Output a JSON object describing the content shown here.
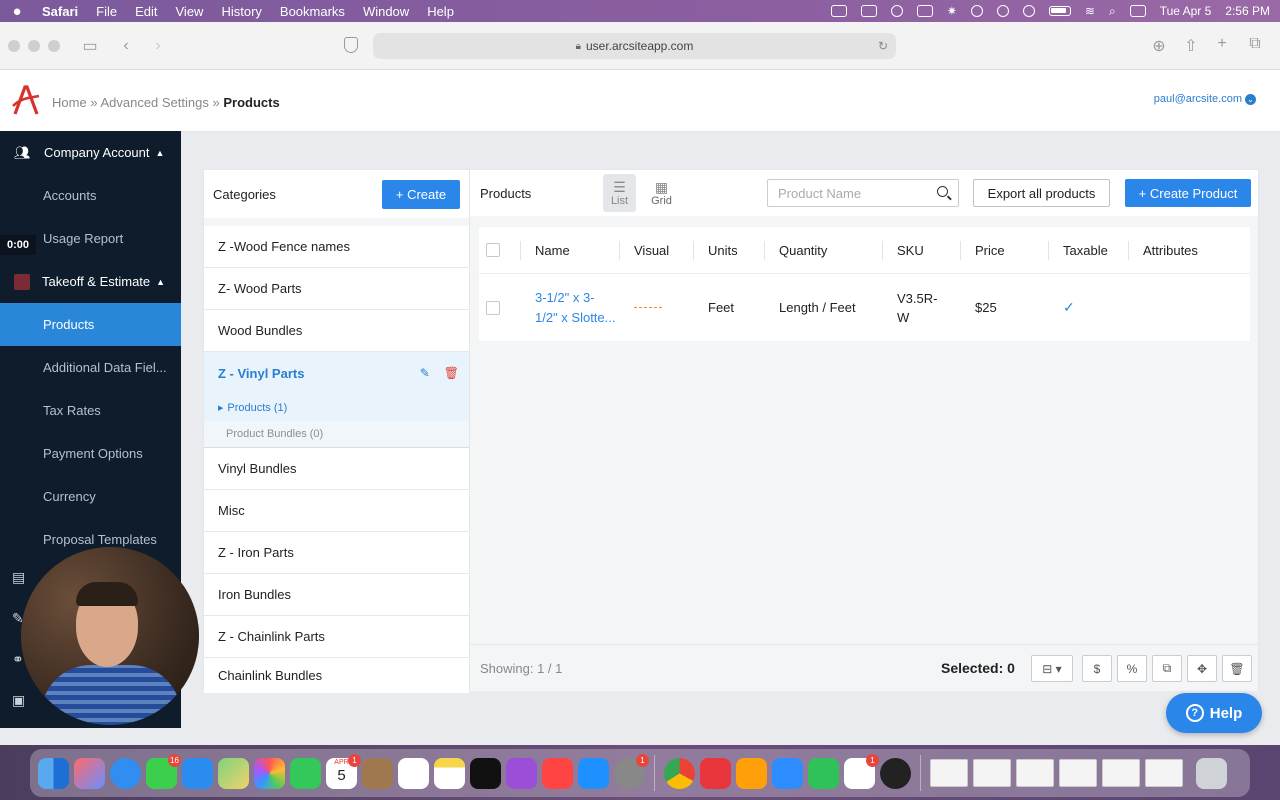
{
  "menubar": {
    "app_name": "Safari",
    "items": [
      "File",
      "Edit",
      "View",
      "History",
      "Bookmarks",
      "Window",
      "Help"
    ],
    "date": "Tue Apr 5",
    "time": "2:56 PM"
  },
  "browser": {
    "url": "user.arcsiteapp.com"
  },
  "header": {
    "breadcrumb": {
      "home": "Home",
      "sep": "»",
      "advanced": "Advanced Settings",
      "current": "Products"
    },
    "user_email": "paul@arcsite.com"
  },
  "sidebar": {
    "company_account": "Company Account",
    "accounts": "Accounts",
    "usage_report": "Usage Report",
    "takeoff_estimate": "Takeoff & Estimate",
    "products": "Products",
    "additional_data": "Additional Data Fiel...",
    "tax_rates": "Tax Rates",
    "payment_options": "Payment Options",
    "currency": "Currency",
    "proposal_templates": "Proposal Templates",
    "timer": "0:00"
  },
  "categories": {
    "title": "Categories",
    "create_label": "+ Create",
    "items_before": [
      "Z -Wood Fence names",
      "Z- Wood Parts",
      "Wood Bundles"
    ],
    "selected": "Z - Vinyl Parts",
    "sub_products": "Products (1)",
    "sub_bundles": "Product Bundles (0)",
    "items_after": [
      "Vinyl Bundles",
      "Misc",
      "Z - Iron Parts",
      "Iron Bundles",
      "Z - Chainlink Parts",
      "Chainlink Bundles"
    ]
  },
  "products": {
    "title": "Products",
    "view_list": "List",
    "view_grid": "Grid",
    "search_placeholder": "Product Name",
    "export_label": "Export all products",
    "create_label": "+ Create Product",
    "columns": [
      "Name",
      "Visual",
      "Units",
      "Quantity",
      "SKU",
      "Price",
      "Taxable",
      "Attributes"
    ],
    "rows": [
      {
        "name_line1": "3-1/2\" x 3-",
        "name_line2": "1/2\" x Slotte...",
        "units": "Feet",
        "quantity": "Length / Feet",
        "sku_line1": "V3.5R-",
        "sku_line2": "W",
        "price": "$25",
        "taxable": "✓"
      }
    ],
    "showing": "Showing: 1 / 1",
    "selected": "Selected: 0"
  },
  "help_label": "Help",
  "dock_badges": {
    "messages": "16",
    "calendar_month": "APR",
    "calendar_day": "5",
    "calendar_badge": "1",
    "settings_badge": "1",
    "slack_badge": "1"
  },
  "colors": {
    "accent": "#2a86e8",
    "sidebar_bg": "#0f1c2b",
    "sidebar_active": "#2a86d9",
    "delete": "#e0403a",
    "visual_dash": "#f08a3c"
  }
}
